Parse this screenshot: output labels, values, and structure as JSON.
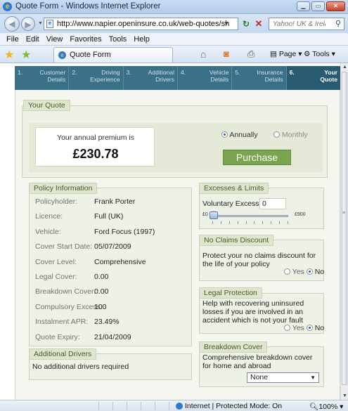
{
  "window": {
    "title": "Quote Form - Windows Internet Explorer",
    "minimize": "▁",
    "maximize": "▭",
    "close": "✕"
  },
  "address_bar": {
    "url": "http://www.napier.openinsure.co.uk/web-quotes/sh",
    "search_placeholder": "Yahoo! UK & Ireland"
  },
  "menu": [
    "File",
    "Edit",
    "View",
    "Favorites",
    "Tools",
    "Help"
  ],
  "tab": {
    "label": "Quote Form"
  },
  "command_bar": {
    "page": "Page",
    "tools": "Tools"
  },
  "steps": [
    {
      "num": "1.",
      "label1": "Customer",
      "label2": "Details",
      "active": false
    },
    {
      "num": "2.",
      "label1": "Driving",
      "label2": "Experience",
      "active": false
    },
    {
      "num": "3.",
      "label1": "Additional",
      "label2": "Drivers",
      "active": false
    },
    {
      "num": "4.",
      "label1": "Vehicle",
      "label2": "Details",
      "active": false
    },
    {
      "num": "5.",
      "label1": "Insurance",
      "label2": "Details",
      "active": false
    },
    {
      "num": "6.",
      "label1": "Your",
      "label2": "Quote",
      "active": true
    }
  ],
  "your_quote": {
    "legend": "Your Quote",
    "premium_label": "Your annual premium is",
    "premium_amount": "£230.78",
    "frequency": {
      "annually": "Annually",
      "monthly": "Monthly",
      "selected": "Annually"
    },
    "purchase_button": "Purchase"
  },
  "policy_information": {
    "legend": "Policy Information",
    "rows": [
      {
        "key": "Policyholder:",
        "value": "Frank Porter"
      },
      {
        "key": "Licence:",
        "value": "Full (UK)"
      },
      {
        "key": "Vehicle:",
        "value": "Ford Focus (1997)"
      },
      {
        "key": "Cover Start Date:",
        "value": "05/07/2009"
      },
      {
        "key": "Cover Level:",
        "value": "Comprehensive"
      },
      {
        "key": "Legal Cover:",
        "value": "0.00"
      },
      {
        "key": "Breakdown Cover:",
        "value": "0.00"
      },
      {
        "key": "Compulsory Excess:",
        "value": "100"
      },
      {
        "key": "Instalment APR:",
        "value": "23.49%"
      },
      {
        "key": "Quote Expiry:",
        "value": "21/04/2009"
      }
    ]
  },
  "additional_drivers": {
    "legend": "Additional Drivers",
    "text": "No additional drivers required"
  },
  "excesses": {
    "legend": "Excesses & Limits",
    "voluntary_label": "Voluntary Excess:",
    "voluntary_value": "0",
    "slider_min": "£0",
    "slider_max": "£900",
    "slider_fraction": 0
  },
  "no_claims": {
    "legend": "No Claims Discount",
    "text": "Protect your no claims discount for the life of your policy",
    "yes": "Yes",
    "no": "No",
    "selected": "No"
  },
  "legal_protection": {
    "legend": "Legal Protection",
    "text": "Help with recovering uninsured losses if you are involved in an accident which is not your fault",
    "yes": "Yes",
    "no": "No",
    "selected": "No"
  },
  "breakdown": {
    "legend": "Breakdown Cover",
    "text": "Comprehensive breakdown cover for home and abroad",
    "selected_option": "None"
  },
  "status_bar": {
    "zone": "Internet | Protected Mode: On",
    "zoom": "100%"
  },
  "colors": {
    "step_bar": "#3a7088",
    "step_active": "#285a72",
    "legend_bg": "#dfe6cf",
    "purchase_bg": "#7aa450"
  }
}
